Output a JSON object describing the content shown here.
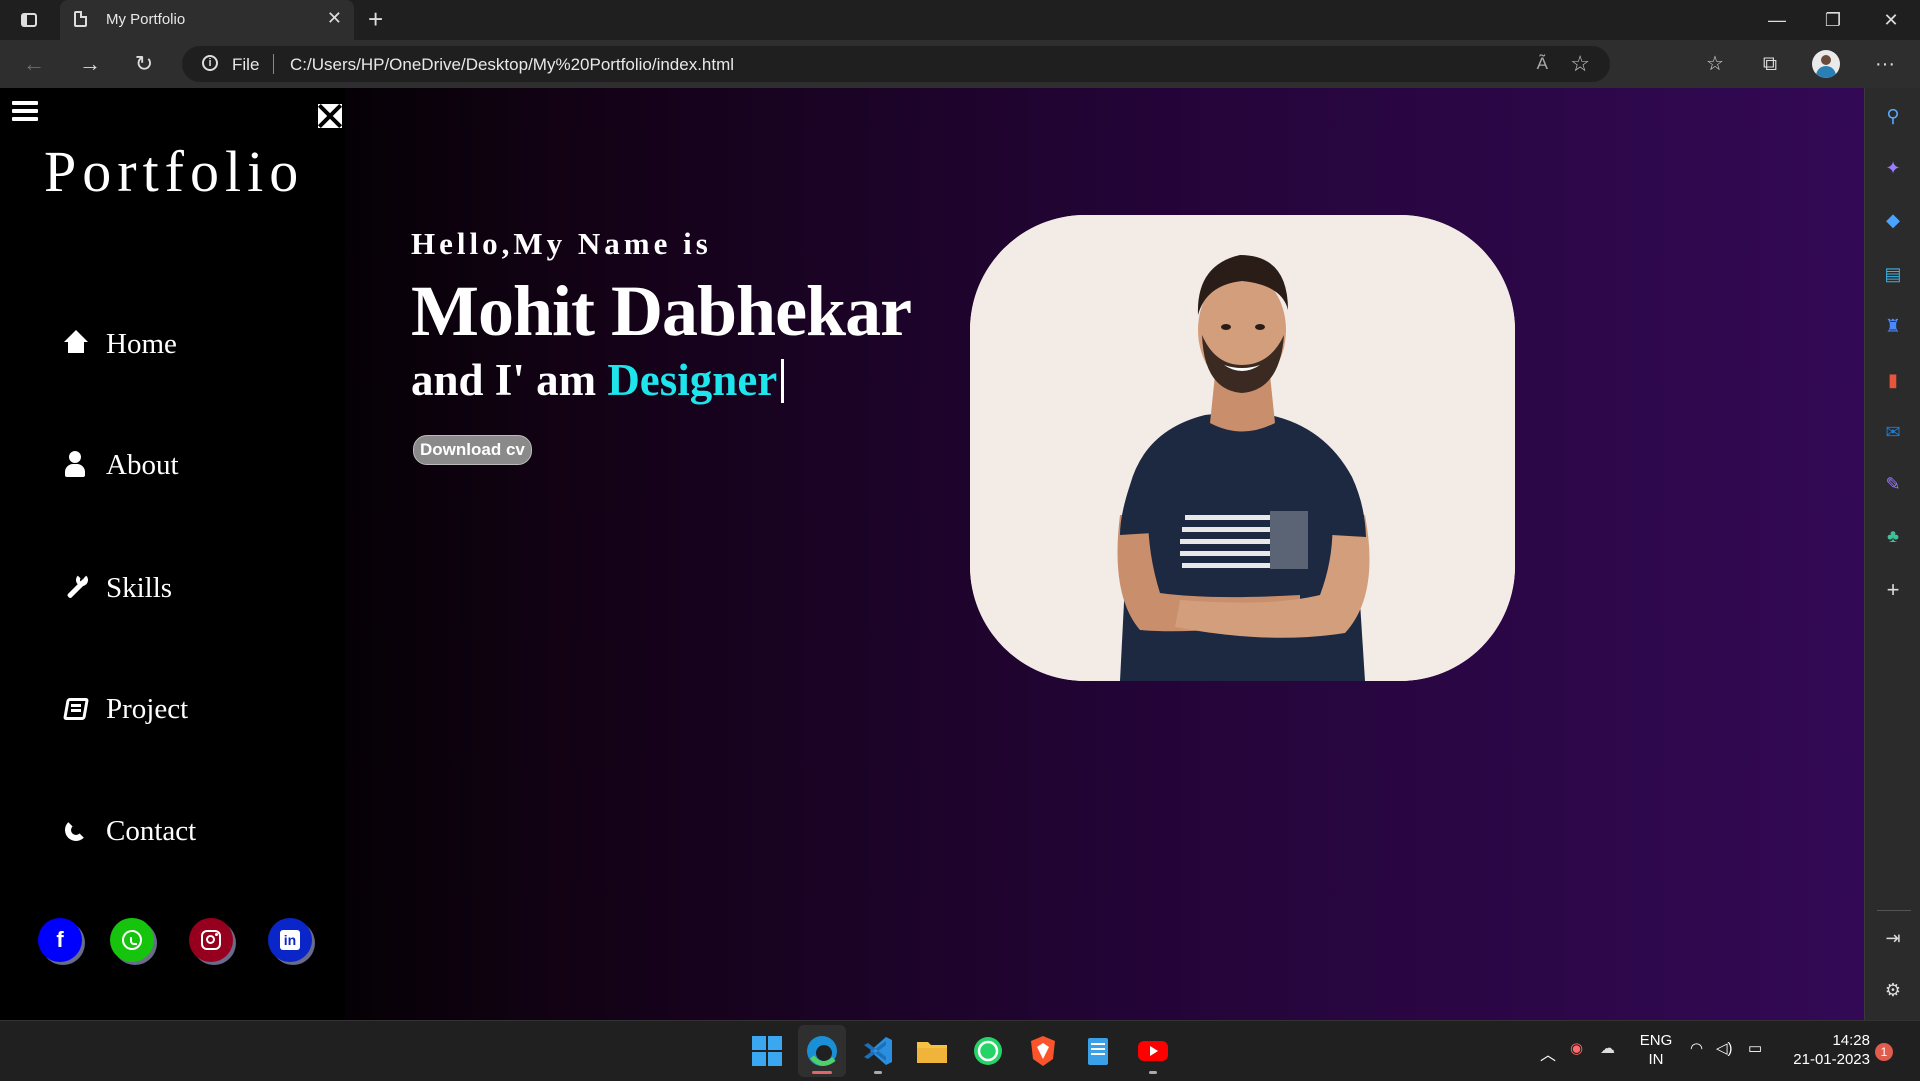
{
  "browser": {
    "tab_title": "My Portfolio",
    "tab_close": "✕",
    "new_tab": "+",
    "scheme_label": "File",
    "url": "C:/Users/HP/OneDrive/Desktop/My%20Portfolio/index.html",
    "window_controls": [
      "—",
      "❐",
      "✕"
    ],
    "read_aloud": "Ã",
    "more": "···"
  },
  "page": {
    "brand": "Portfolio",
    "nav": [
      {
        "label": "Home",
        "icon": "home-icon"
      },
      {
        "label": "About",
        "icon": "user-icon"
      },
      {
        "label": "Skills",
        "icon": "wrench-icon"
      },
      {
        "label": "Project",
        "icon": "book-icon"
      },
      {
        "label": "Contact",
        "icon": "phone-icon"
      }
    ],
    "hero": {
      "greeting": "Hello,My Name is",
      "name": "Mohit Dabhekar",
      "role_prefix": "and I' am",
      "role_word": "Designer",
      "download_label": "Download cv"
    },
    "social": [
      {
        "name": "facebook-icon",
        "glyph": "f",
        "color": "#0000ff"
      },
      {
        "name": "whatsapp-icon",
        "color": "#17c40d"
      },
      {
        "name": "instagram-icon",
        "color": "#96001e"
      },
      {
        "name": "linkedin-icon",
        "glyph": "in",
        "color": "#0a26c8"
      }
    ],
    "accent_color": "#1ee5ec"
  },
  "taskbar": {
    "lang_primary": "ENG",
    "lang_secondary": "IN",
    "time": "14:28",
    "date": "21-01-2023",
    "notification_count": "1"
  }
}
